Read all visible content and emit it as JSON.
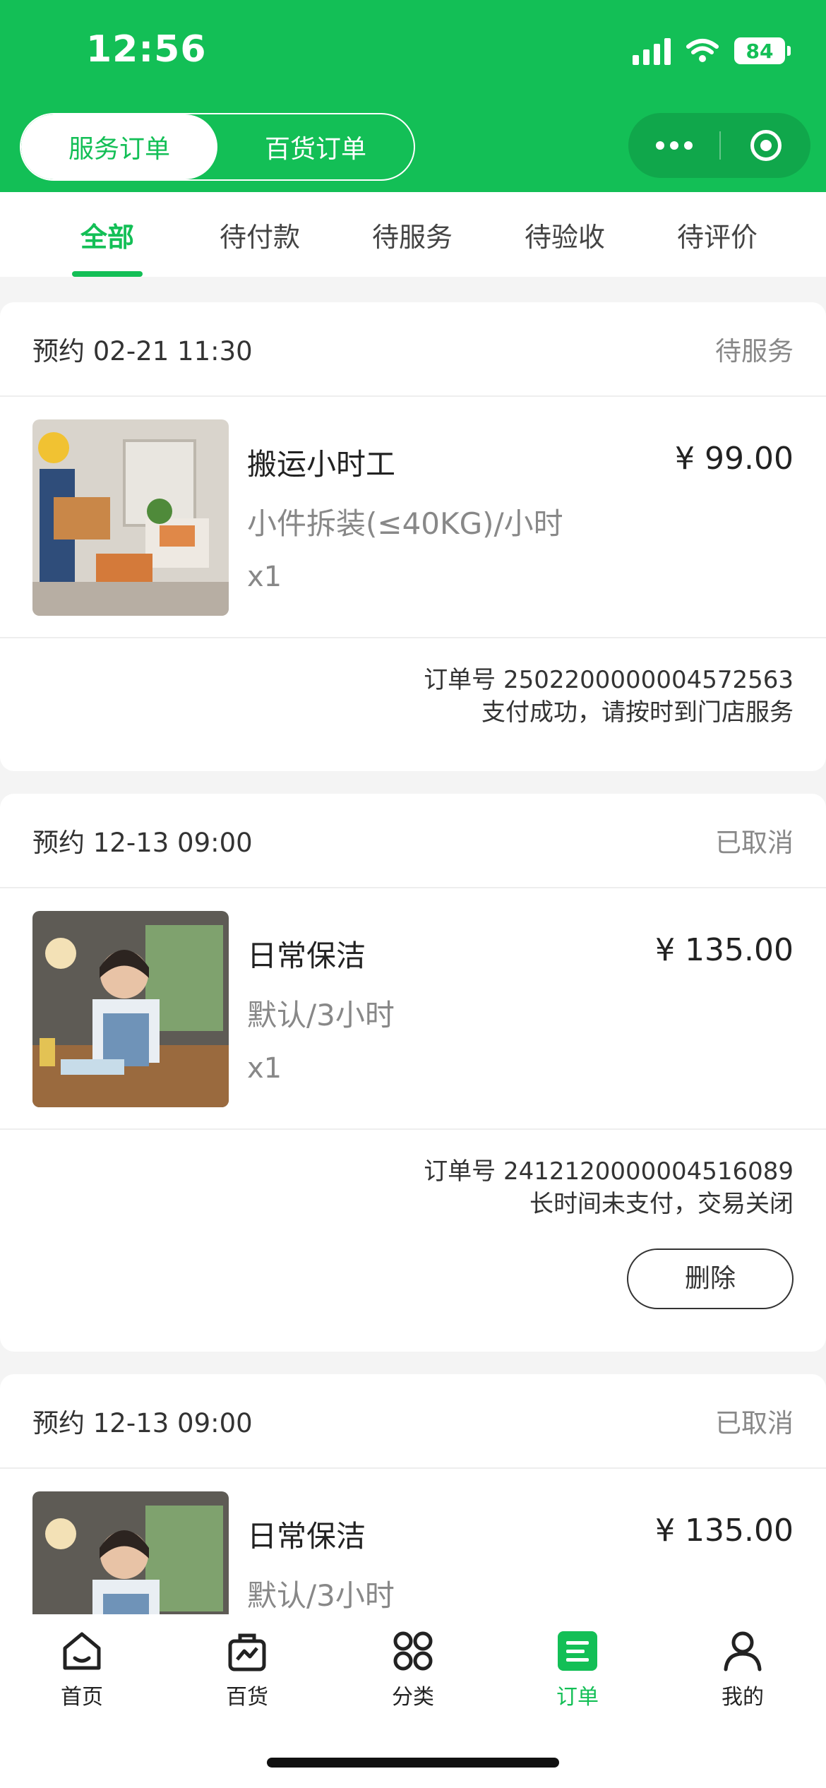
{
  "status_bar": {
    "time": "12:56",
    "battery": "84"
  },
  "header": {
    "segments": [
      {
        "label": "服务订单",
        "active": true
      },
      {
        "label": "百货订单",
        "active": false
      }
    ]
  },
  "tabs": [
    {
      "label": "全部",
      "active": true
    },
    {
      "label": "待付款",
      "active": false
    },
    {
      "label": "待服务",
      "active": false
    },
    {
      "label": "待验收",
      "active": false
    },
    {
      "label": "待评价",
      "active": false
    }
  ],
  "orders": [
    {
      "appointment": "预约 02-21 11:30",
      "status": "待服务",
      "title": "搬运小时工",
      "price": "¥ 99.00",
      "spec": "小件拆装(≤40KG)/小时",
      "qty": "x1",
      "order_no": "订单号 2502200000004572563",
      "note": "支付成功，请按时到门店服务"
    },
    {
      "appointment": "预约 12-13 09:00",
      "status": "已取消",
      "title": "日常保洁",
      "price": "¥ 135.00",
      "spec": "默认/3小时",
      "qty": "x1",
      "order_no": "订单号 2412120000004516089",
      "note": "长时间未支付，交易关闭",
      "delete_label": "删除"
    },
    {
      "appointment": "预约 12-13 09:00",
      "status": "已取消",
      "title": "日常保洁",
      "price": "¥ 135.00",
      "spec": "默认/3小时"
    }
  ],
  "tabbar": [
    {
      "label": "首页",
      "icon": "home-icon"
    },
    {
      "label": "百货",
      "icon": "shopping-bag-icon"
    },
    {
      "label": "分类",
      "icon": "category-icon"
    },
    {
      "label": "订单",
      "icon": "order-icon",
      "active": true
    },
    {
      "label": "我的",
      "icon": "profile-icon"
    }
  ],
  "colors": {
    "brand": "#13bf56"
  }
}
